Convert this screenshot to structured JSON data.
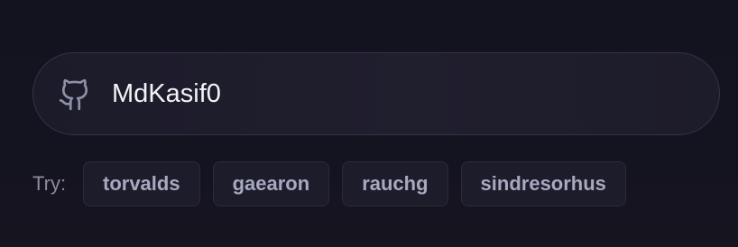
{
  "search": {
    "icon": "github-icon",
    "value": "MdKasif0",
    "placeholder": ""
  },
  "suggestions": {
    "label": "Try:",
    "items": [
      "torvalds",
      "gaearon",
      "rauchg",
      "sindresorhus"
    ]
  },
  "colors": {
    "background": "#13131f",
    "input_text": "#f3f3f7",
    "chip_text": "#a7a9bf",
    "muted_text": "#8b8b9b"
  }
}
